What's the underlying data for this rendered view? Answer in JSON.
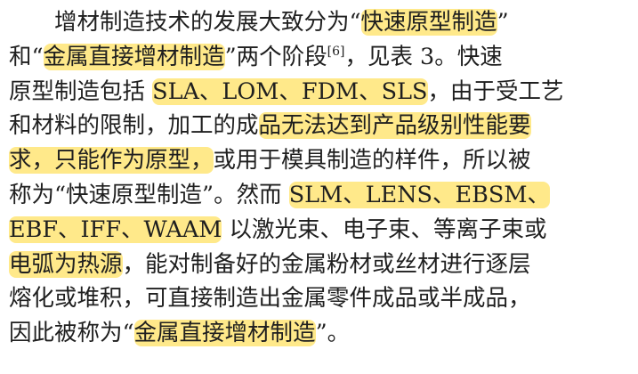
{
  "highlight_color": "#ffe98a",
  "paragraph": {
    "lines": [
      {
        "segments": [
          {
            "text": "　　增材制造技术的发展大致分为“",
            "hl": false
          },
          {
            "text": "快速原型制造",
            "hl": true
          },
          {
            "text": "”",
            "hl": false
          }
        ]
      },
      {
        "segments": [
          {
            "text": "和“",
            "hl": false
          },
          {
            "text": "金属直接增材制造",
            "hl": true
          },
          {
            "text": "”两个阶段",
            "hl": false
          },
          {
            "text": "[6]",
            "hl": false,
            "sup": true
          },
          {
            "text": "，见表 3。快速",
            "hl": false
          }
        ]
      },
      {
        "segments": [
          {
            "text": "原型制造包括 ",
            "hl": false
          },
          {
            "text": "SLA、LOM、FDM、SLS",
            "hl": true
          },
          {
            "text": "，由于受工艺",
            "hl": false
          }
        ]
      },
      {
        "segments": [
          {
            "text": "和材料的限制，加工的成",
            "hl": false
          },
          {
            "text": "品无法达到产品级别性能要",
            "hl": true
          }
        ]
      },
      {
        "segments": [
          {
            "text": "求，只能作为原型，",
            "hl": true
          },
          {
            "text": "或用于模具制造的样件，所以被",
            "hl": false
          }
        ]
      },
      {
        "segments": [
          {
            "text": "称为“快速原型制造”。然而 ",
            "hl": false
          },
          {
            "text": "SLM、LENS、EBSM、",
            "hl": true
          }
        ]
      },
      {
        "segments": [
          {
            "text": "EBF、IFF、WAAM",
            "hl": true
          },
          {
            "text": " 以激光束、电子束、等离子束或",
            "hl": false
          }
        ]
      },
      {
        "segments": [
          {
            "text": "电弧为热源",
            "hl": true
          },
          {
            "text": "，能对制备好的金属粉材或丝材进行逐层",
            "hl": false
          }
        ]
      },
      {
        "segments": [
          {
            "text": "熔化或堆积，可直接制造出金属零件成品或半成品，",
            "hl": false
          }
        ]
      },
      {
        "segments": [
          {
            "text": "因此被称为“",
            "hl": false
          },
          {
            "text": "金属直接增材制造",
            "hl": true
          },
          {
            "text": "”。",
            "hl": false
          }
        ]
      }
    ]
  }
}
